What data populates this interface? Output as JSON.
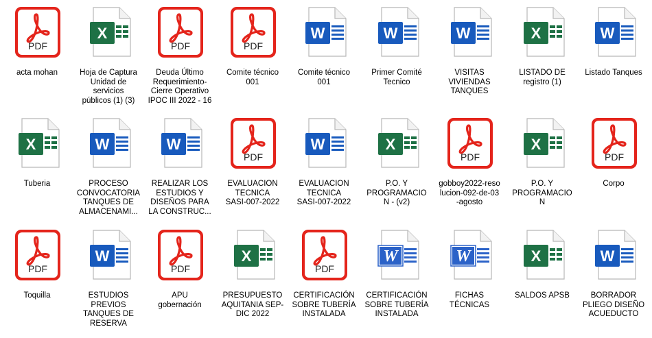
{
  "rows": [
    [
      {
        "type": "pdf",
        "name": "acta mohan"
      },
      {
        "type": "excel",
        "name": "Hoja de Captura\nUnidad de\nservicios\npúblicos (1) (3)"
      },
      {
        "type": "pdf",
        "name": "Deuda Último\nRequerimiento-\nCierre Operativo\nIPOC III 2022 - 16"
      },
      {
        "type": "pdf",
        "name": "Comite técnico\n001"
      },
      {
        "type": "word",
        "name": "Comite técnico\n001"
      },
      {
        "type": "word",
        "name": "Primer Comité\nTecnico"
      },
      {
        "type": "word",
        "name": "VISITAS\nVIVIENDAS\nTANQUES"
      },
      {
        "type": "excel",
        "name": "LISTADO DE\nregistro (1)"
      },
      {
        "type": "word",
        "name": "Listado Tanques"
      }
    ],
    [
      {
        "type": "excel",
        "name": "Tuberia"
      },
      {
        "type": "word",
        "name": "PROCESO\nCONVOCATORIA\nTANQUES DE\nALMACENAMI..."
      },
      {
        "type": "word",
        "name": "REALIZAR LOS\nESTUDIOS Y\nDISEÑOS PARA\nLA CONSTRUC..."
      },
      {
        "type": "pdf",
        "name": "EVALUACION\nTECNICA\nSASI-007-2022"
      },
      {
        "type": "word",
        "name": "EVALUACION\nTECNICA\nSASI-007-2022"
      },
      {
        "type": "excel",
        "name": "P.O. Y\nPROGRAMACIO\nN - (v2)"
      },
      {
        "type": "pdf",
        "name": "gobboy2022-reso\nlucion-092-de-03\n-agosto"
      },
      {
        "type": "excel",
        "name": "P.O. Y\nPROGRAMACIO\nN"
      },
      {
        "type": "pdf",
        "name": "Corpo"
      }
    ],
    [
      {
        "type": "pdf",
        "name": "Toquilla"
      },
      {
        "type": "word",
        "name": "ESTUDIOS\nPREVIOS\nTANQUES DE\nRESERVA"
      },
      {
        "type": "pdf",
        "name": "APU\ngobernación"
      },
      {
        "type": "excel",
        "name": "PRESUPUESTO\nAQUITANIA SEP-\nDIC 2022"
      },
      {
        "type": "pdf",
        "name": "CERTIFICACIÓN\nSOBRE TUBERÍA\nINSTALADA"
      },
      {
        "type": "wordold",
        "name": "CERTIFICACIÓN\nSOBRE TUBERÍA\nINSTALADA"
      },
      {
        "type": "wordold",
        "name": "FICHAS\nTÉCNICAS"
      },
      {
        "type": "excel",
        "name": "SALDOS APSB"
      },
      {
        "type": "word",
        "name": "BORRADOR\nPLIEGO DISEÑO\nACUEDUCTO"
      }
    ]
  ],
  "icon_labels": {
    "pdf": "PDF",
    "excel": "X",
    "word": "W",
    "wordold": "W"
  },
  "colors": {
    "pdf_red": "#e4241b",
    "excel_green": "#1e7145",
    "word_blue": "#185abd",
    "wordold_blue": "#2b62c8"
  }
}
